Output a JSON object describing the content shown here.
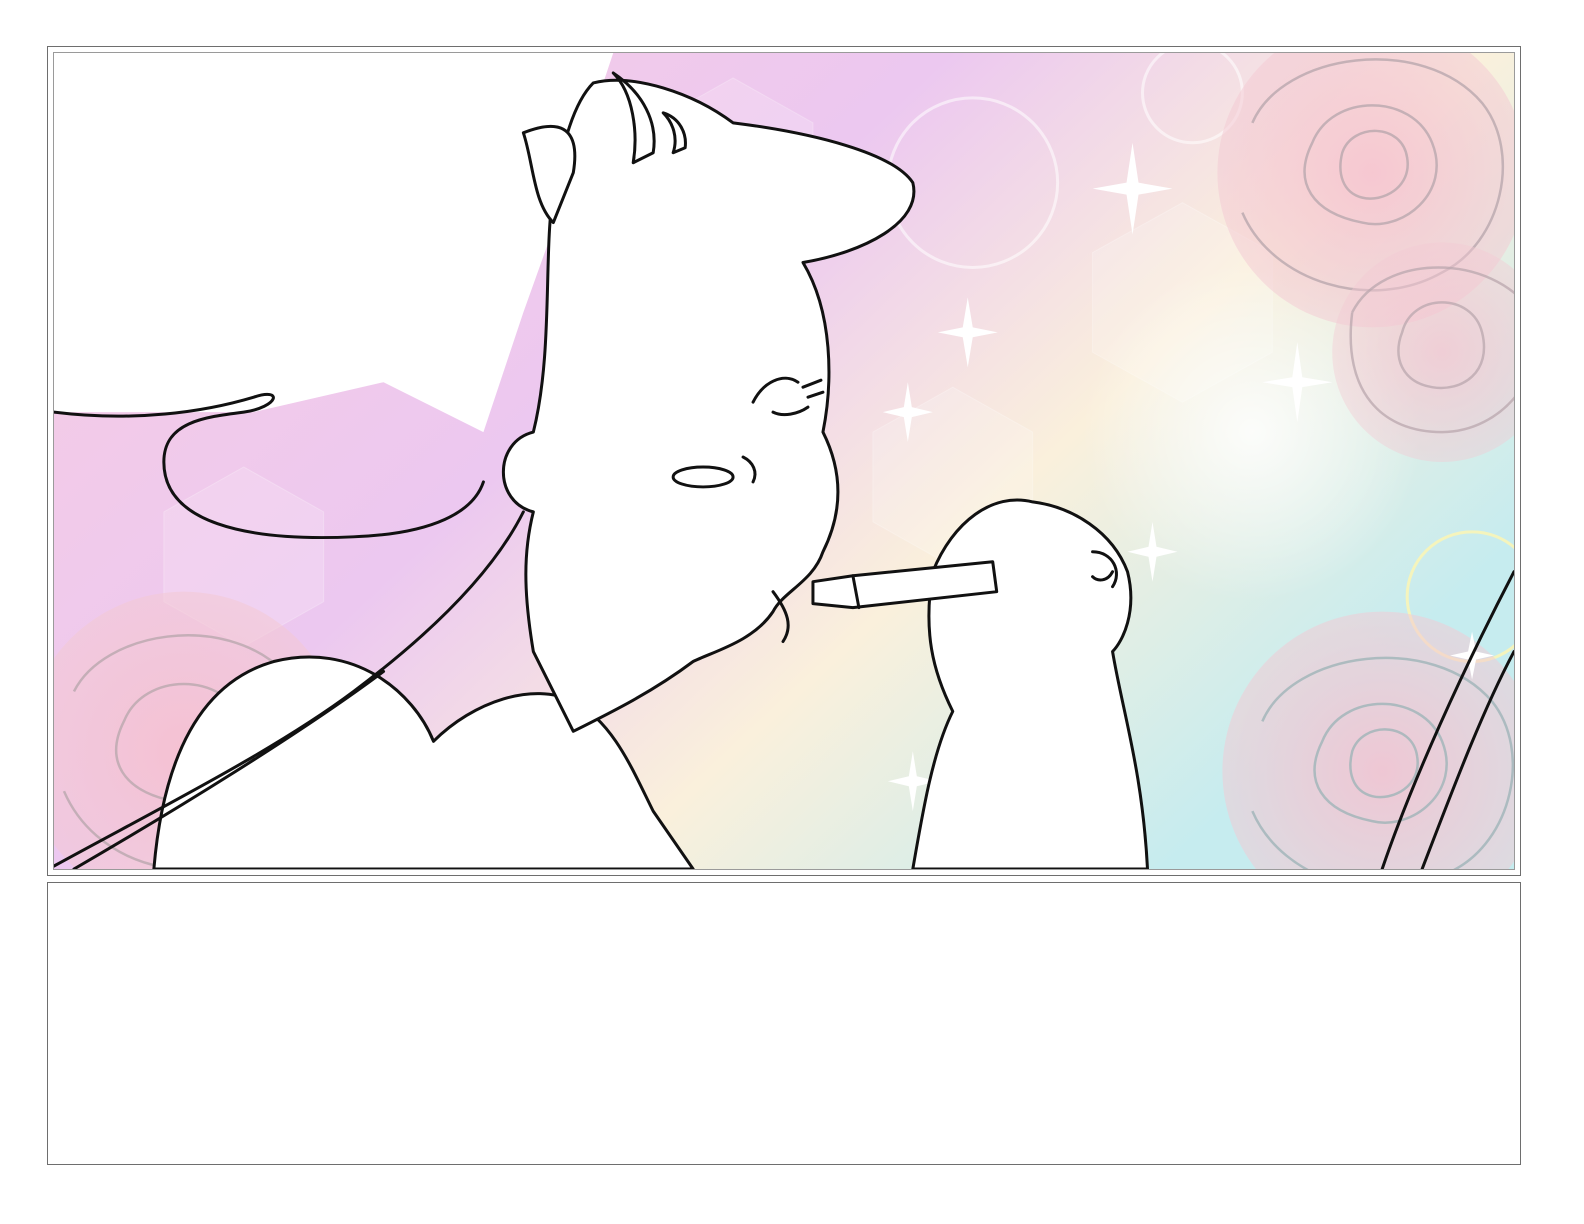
{
  "page": {
    "background_color": "#ffffff",
    "frame_color": "#6e6e6e"
  },
  "panel": {
    "background_colors": [
      "#f7c6df",
      "#e9c8f2",
      "#f9f2d8",
      "#c9ecef"
    ],
    "rose_color": "#f2b3c6",
    "line_color": "#111111",
    "sparkle_color": "#ffffff"
  },
  "caption_box": {
    "text": ""
  }
}
